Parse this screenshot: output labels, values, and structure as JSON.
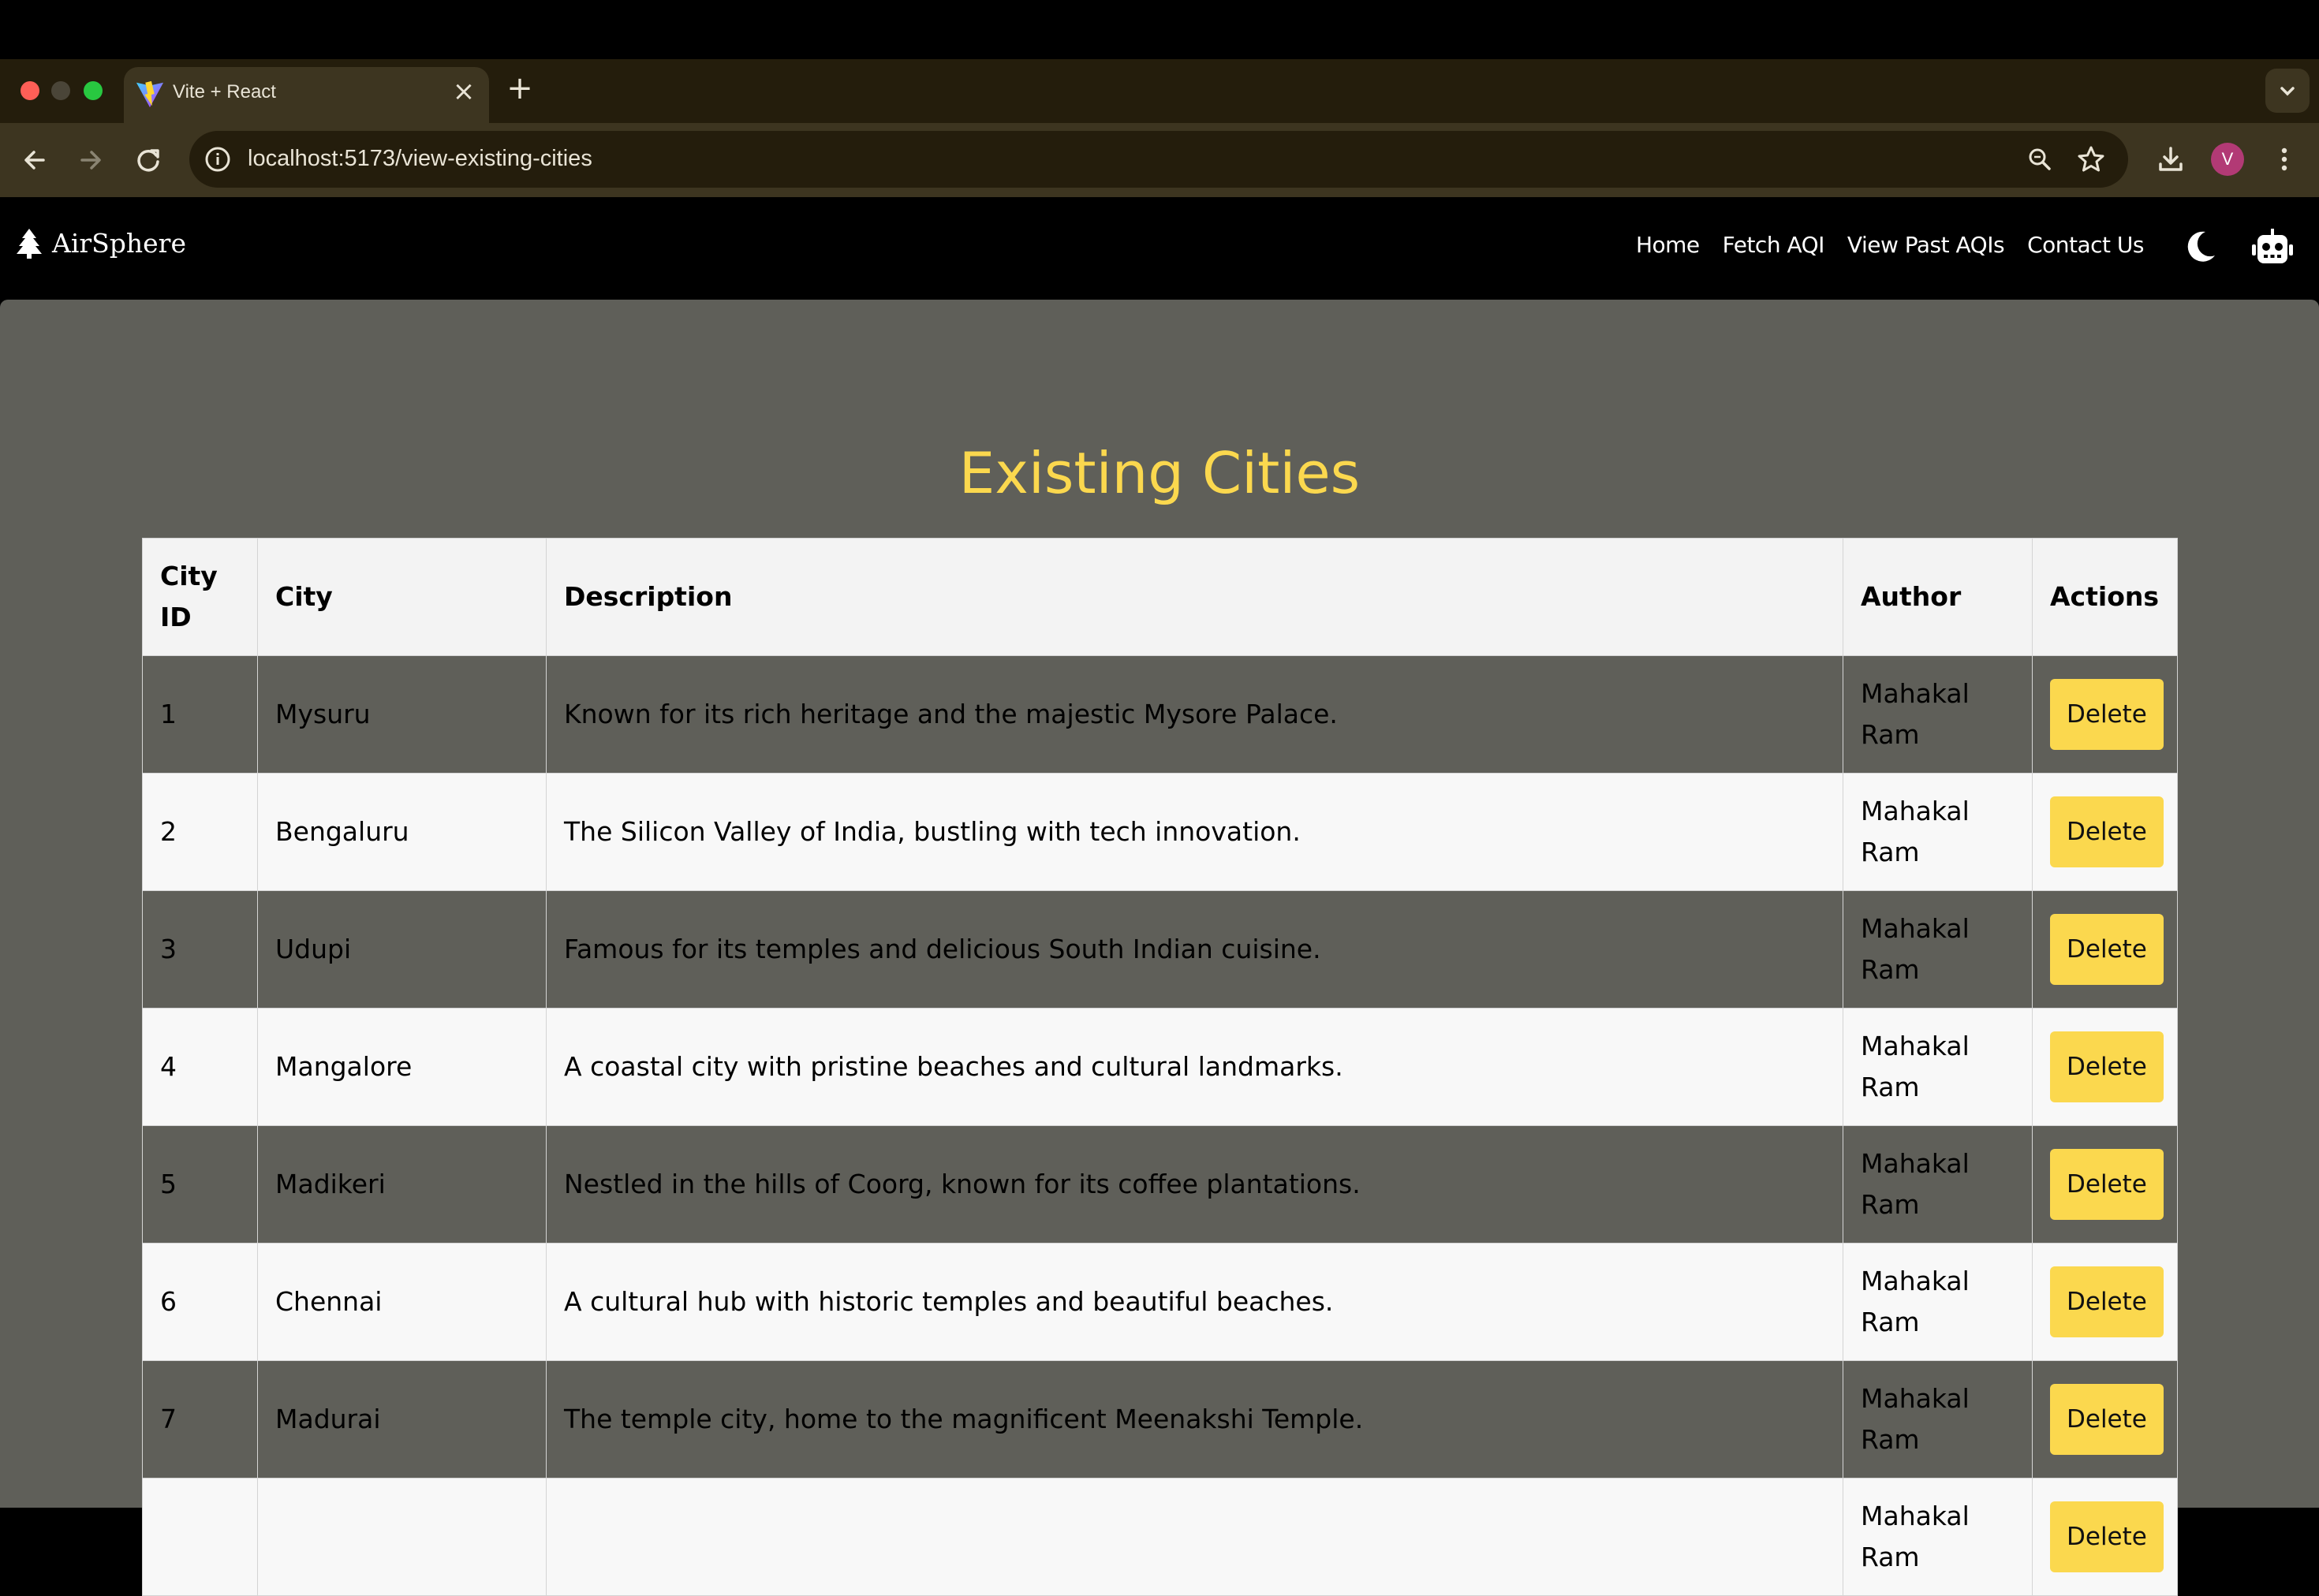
{
  "browser": {
    "tab_title": "Vite + React",
    "url": "localhost:5173/view-existing-cities",
    "profile_initial": "V"
  },
  "app": {
    "brand": "AirSphere",
    "nav": [
      {
        "label": "Home"
      },
      {
        "label": "Fetch AQI"
      },
      {
        "label": "View Past AQIs"
      },
      {
        "label": "Contact Us"
      }
    ]
  },
  "page": {
    "title": "Existing Cities"
  },
  "table": {
    "headers": [
      "City ID",
      "City",
      "Description",
      "Author",
      "Actions"
    ],
    "rows": [
      {
        "id": "1",
        "city": "Mysuru",
        "description": "Known for its rich heritage and the majestic Mysore Palace.",
        "author": "Mahakal Ram",
        "action": "Delete"
      },
      {
        "id": "2",
        "city": "Bengaluru",
        "description": "The Silicon Valley of India, bustling with tech innovation.",
        "author": "Mahakal Ram",
        "action": "Delete"
      },
      {
        "id": "3",
        "city": "Udupi",
        "description": "Famous for its temples and delicious South Indian cuisine.",
        "author": "Mahakal Ram",
        "action": "Delete"
      },
      {
        "id": "4",
        "city": "Mangalore",
        "description": "A coastal city with pristine beaches and cultural landmarks.",
        "author": "Mahakal Ram",
        "action": "Delete"
      },
      {
        "id": "5",
        "city": "Madikeri",
        "description": "Nestled in the hills of Coorg, known for its coffee plantations.",
        "author": "Mahakal Ram",
        "action": "Delete"
      },
      {
        "id": "6",
        "city": "Chennai",
        "description": "A cultural hub with historic temples and beautiful beaches.",
        "author": "Mahakal Ram",
        "action": "Delete"
      },
      {
        "id": "7",
        "city": "Madurai",
        "description": "The temple city, home to the magnificent Meenakshi Temple.",
        "author": "Mahakal Ram",
        "action": "Delete"
      },
      {
        "id": "",
        "city": "",
        "description": "",
        "author": "Mahakal Ram",
        "action": "Delete"
      }
    ]
  },
  "colors": {
    "accent": "#fbd84e",
    "background": "#5f5f59",
    "navbar": "#000000"
  }
}
